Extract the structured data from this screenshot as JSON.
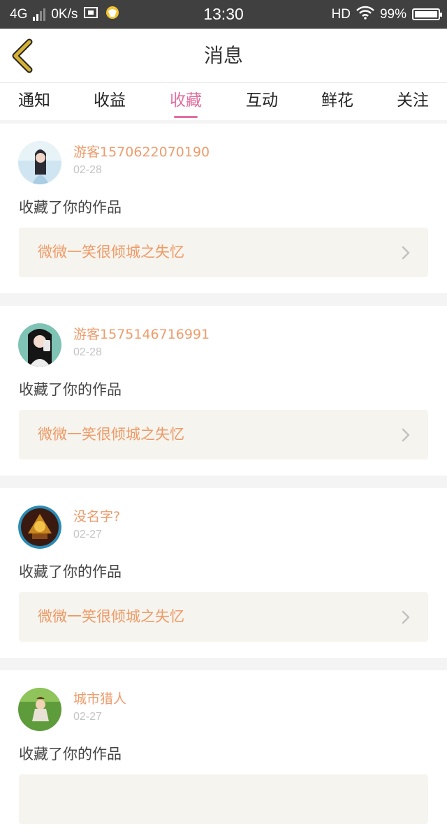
{
  "status_bar": {
    "network": "4G",
    "speed": "0K/s",
    "time": "13:30",
    "hd": "HD",
    "battery": "99%"
  },
  "header": {
    "title": "消息"
  },
  "tabs": [
    {
      "label": "通知",
      "active": false
    },
    {
      "label": "收益",
      "active": false
    },
    {
      "label": "收藏",
      "active": true
    },
    {
      "label": "互动",
      "active": false
    },
    {
      "label": "鲜花",
      "active": false
    },
    {
      "label": "关注",
      "active": false
    }
  ],
  "items": [
    {
      "username": "游客1570622070190",
      "date": "02-28",
      "action": "收藏了你的作品",
      "work": "微微一笑很倾城之失忆"
    },
    {
      "username": "游客1575146716991",
      "date": "02-28",
      "action": "收藏了你的作品",
      "work": "微微一笑很倾城之失忆"
    },
    {
      "username": "没名字?",
      "date": "02-27",
      "action": "收藏了你的作品",
      "work": "微微一笑很倾城之失忆"
    },
    {
      "username": "城市猎人",
      "date": "02-27",
      "action": "收藏了你的作品",
      "work": ""
    }
  ],
  "colors": {
    "accent": "#e06fa0",
    "username": "#ee9c6c",
    "work_title": "#ef9a67",
    "back_arrow": "#d6b234"
  }
}
